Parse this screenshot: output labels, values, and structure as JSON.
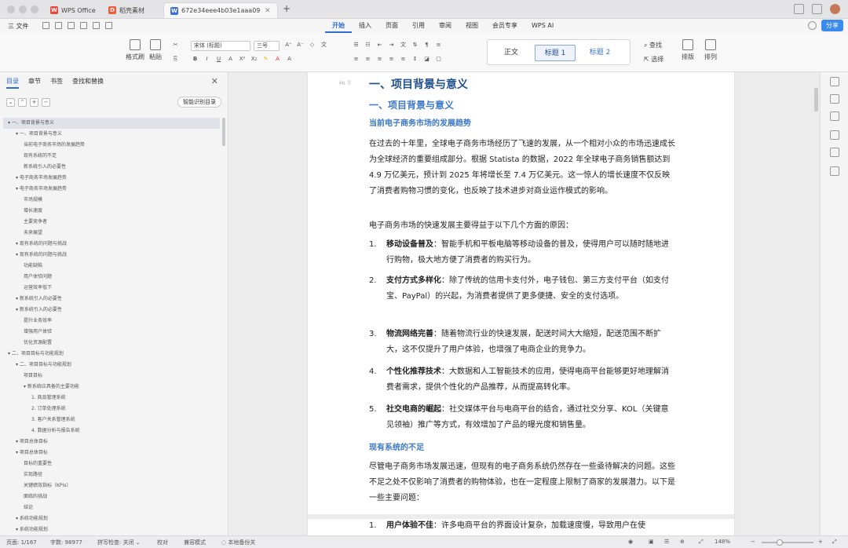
{
  "tabs": [
    {
      "label": "WPS Office",
      "icon": "wps-logo-icon",
      "color": "#e8453c"
    },
    {
      "label": "稻壳素材",
      "icon": "daoke-logo-icon",
      "color": "#ef5a3b"
    },
    {
      "label": "672e34eee4b03e1aaa098",
      "icon": "doc-icon",
      "color": "#3b6fe0"
    }
  ],
  "menubar": {
    "file": "三 文件",
    "tabs": [
      "开始",
      "插入",
      "页面",
      "引用",
      "审阅",
      "视图",
      "会员专享",
      "WPS AI"
    ],
    "active_tab": "开始",
    "share": "分享"
  },
  "ribbon": {
    "format_painter": "格式刷",
    "paste": "粘贴",
    "font": "宋体 (标题)",
    "size": "三号",
    "styles": [
      "正文",
      "标题 1",
      "标题 2"
    ],
    "find": "查找",
    "select": "选择",
    "layout": "排版",
    "arrange": "排列"
  },
  "sidebar": {
    "tabs": [
      "目录",
      "章节",
      "书签",
      "查找和替换"
    ],
    "active_tab": "目录",
    "smart_btn": "智能识别目录",
    "toc": [
      {
        "text": "▾ 一、项目背景与意义",
        "level": 0,
        "selected": true
      },
      {
        "text": "▾ 一、项目背景与意义",
        "level": 1
      },
      {
        "text": "当前电子商务市场的发展趋势",
        "level": 2
      },
      {
        "text": "现有系统的不足",
        "level": 2
      },
      {
        "text": "新系统引入的必要性",
        "level": 2
      },
      {
        "text": "▾ 电子商务市场发展趋势",
        "level": 1
      },
      {
        "text": "▾ 电子商务市场发展趋势",
        "level": 1
      },
      {
        "text": "市场规模",
        "level": 2
      },
      {
        "text": "增长速度",
        "level": 2
      },
      {
        "text": "主要竞争者",
        "level": 2
      },
      {
        "text": "未来展望",
        "level": 2
      },
      {
        "text": "▾ 现有系统的问题与挑战",
        "level": 1
      },
      {
        "text": "▾ 现有系统的问题与挑战",
        "level": 1
      },
      {
        "text": "功能缺陷",
        "level": 2
      },
      {
        "text": "用户体验问题",
        "level": 2
      },
      {
        "text": "运营效率低下",
        "level": 2
      },
      {
        "text": "▾ 新系统引入的必要性",
        "level": 1
      },
      {
        "text": "▾ 新系统引入的必要性",
        "level": 1
      },
      {
        "text": "提升业务效率",
        "level": 2
      },
      {
        "text": "增强用户体验",
        "level": 2
      },
      {
        "text": "优化资源配置",
        "level": 2
      },
      {
        "text": "▾ 二、项目目标与功能规划",
        "level": 0
      },
      {
        "text": "▾ 二、项目目标与功能规划",
        "level": 1
      },
      {
        "text": "项目目标",
        "level": 2
      },
      {
        "text": "▾ 新系统应具备的主要功能",
        "level": 2
      },
      {
        "text": "1. 商品管理系统",
        "level": 3
      },
      {
        "text": "2. 订单处理系统",
        "level": 3
      },
      {
        "text": "3. 客户关系管理系统",
        "level": 3
      },
      {
        "text": "4. 数据分析与报告系统",
        "level": 3
      },
      {
        "text": "▾ 项目总体目标",
        "level": 1
      },
      {
        "text": "▾ 项目总体目标",
        "level": 1
      },
      {
        "text": "目标的重要性",
        "level": 2
      },
      {
        "text": "实现路径",
        "level": 2
      },
      {
        "text": "关键绩效指标（KPIs）",
        "level": 2
      },
      {
        "text": "面临的挑战",
        "level": 2
      },
      {
        "text": "结论",
        "level": 2
      },
      {
        "text": "▾ 系统功能规划",
        "level": 1
      },
      {
        "text": "▾ 系统功能规划",
        "level": 1
      }
    ]
  },
  "document": {
    "h1": "一、项目背景与意义",
    "h2": "一、项目背景与意义",
    "h3a": "当前电子商务市场的发展趋势",
    "p1": "在过去的十年里，全球电子商务市场经历了飞速的发展，从一个相对小众的市场迅速成长为全球经济的重要组成部分。根据 Statista 的数据，2022 年全球电子商务销售额达到 4.9 万亿美元，预计到 2025 年将增长至 7.4 万亿美元。这一惊人的增长速度不仅反映了消费者购物习惯的变化，也反映了技术进步对商业运作模式的影响。",
    "p2": "电子商务市场的快速发展主要得益于以下几个方面的原因：",
    "list": [
      {
        "num": "1.",
        "title": "移动设备普及",
        "text": "：智能手机和平板电脑等移动设备的普及，使得用户可以随时随地进行购物，极大地方便了消费者的购买行为。"
      },
      {
        "num": "2.",
        "title": "支付方式多样化",
        "text": "：除了传统的信用卡支付外，电子钱包、第三方支付平台（如支付宝、PayPal）的兴起，为消费者提供了更多便捷、安全的支付选项。"
      },
      {
        "num": "3.",
        "title": "物流网络完善",
        "text": "：随着物流行业的快速发展，配送时间大大缩短，配送范围不断扩大，这不仅提升了用户体验，也增强了电商企业的竞争力。"
      },
      {
        "num": "4.",
        "title": "个性化推荐技术",
        "text": "：大数据和人工智能技术的应用，使得电商平台能够更好地理解消费者需求，提供个性化的产品推荐，从而提高转化率。"
      },
      {
        "num": "5.",
        "title": "社交电商的崛起",
        "text": "：社交媒体平台与电商平台的结合，通过社交分享、KOL（关键意见领袖）推广等方式，有效增加了产品的曝光度和销售量。"
      }
    ],
    "h3b": "现有系统的不足",
    "p3": "尽管电子商务市场发展迅速，但现有的电子商务系统仍然存在一些亟待解决的问题。这些不足之处不仅影响了消费者的购物体验，也在一定程度上限制了商家的发展潜力。以下是一些主要问题：",
    "list2": {
      "num": "1.",
      "title": "用户体验不佳",
      "text": "：许多电商平台的界面设计复杂，加载速度慢，导致用户在使"
    }
  },
  "status": {
    "page": "页面: 1/167",
    "words": "字数: 98977",
    "spell": "拼写检查: 关闭 ⌄",
    "proof": "校对",
    "compat": "兼容模式",
    "backup": "本地备份关",
    "zoom": "148%",
    "zoom_level": 0.35
  }
}
